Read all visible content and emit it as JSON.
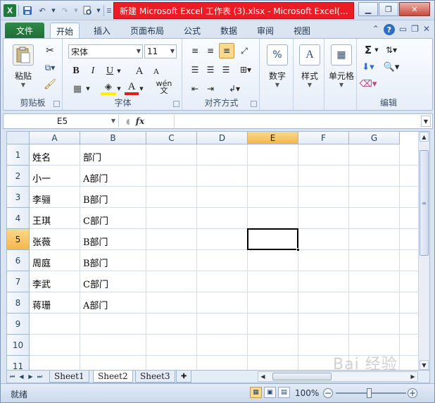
{
  "window": {
    "title": "新建 Microsoft Excel 工作表 (3).xlsx - Microsoft Excel(..."
  },
  "ribbon": {
    "tabs": [
      "文件",
      "开始",
      "插入",
      "页面布局",
      "公式",
      "数据",
      "审阅",
      "视图"
    ],
    "active_tab": "开始",
    "clipboard": {
      "paste_label": "粘贴",
      "group_label": "剪贴板"
    },
    "font": {
      "font_name": "宋体",
      "font_size": "11",
      "group_label": "字体",
      "bold": "B",
      "italic": "I",
      "underline": "U",
      "grow": "A",
      "shrink": "A",
      "color_a": "A",
      "phonetic": "wén"
    },
    "alignment": {
      "group_label": "对齐方式"
    },
    "number": {
      "label": "数字",
      "icon_text": "%"
    },
    "styles": {
      "label": "样式"
    },
    "cells": {
      "label": "单元格"
    },
    "editing": {
      "group_label": "编辑",
      "sum": "Σ"
    }
  },
  "formula_bar": {
    "name_box": "E5",
    "fx": "fx",
    "value": ""
  },
  "grid": {
    "columns": [
      "A",
      "B",
      "C",
      "D",
      "E",
      "F",
      "G"
    ],
    "selected_column": "E",
    "rows": [
      "1",
      "2",
      "3",
      "4",
      "5",
      "6",
      "7",
      "8",
      "9",
      "10",
      "11"
    ],
    "selected_row": "5",
    "cells": [
      [
        "姓名",
        "部门"
      ],
      [
        "小一",
        "A部门"
      ],
      [
        "李骊",
        "B部门"
      ],
      [
        "王琪",
        "C部门"
      ],
      [
        "张薇",
        "B部门"
      ],
      [
        "周庭",
        "B部门"
      ],
      [
        "李武",
        "C部门"
      ],
      [
        "蒋珊",
        "A部门"
      ]
    ]
  },
  "sheets": {
    "tabs": [
      "Sheet1",
      "Sheet2",
      "Sheet3"
    ],
    "active": "Sheet2"
  },
  "status": {
    "ready": "就绪",
    "zoom": "100%"
  },
  "watermark": "Bai 经验"
}
